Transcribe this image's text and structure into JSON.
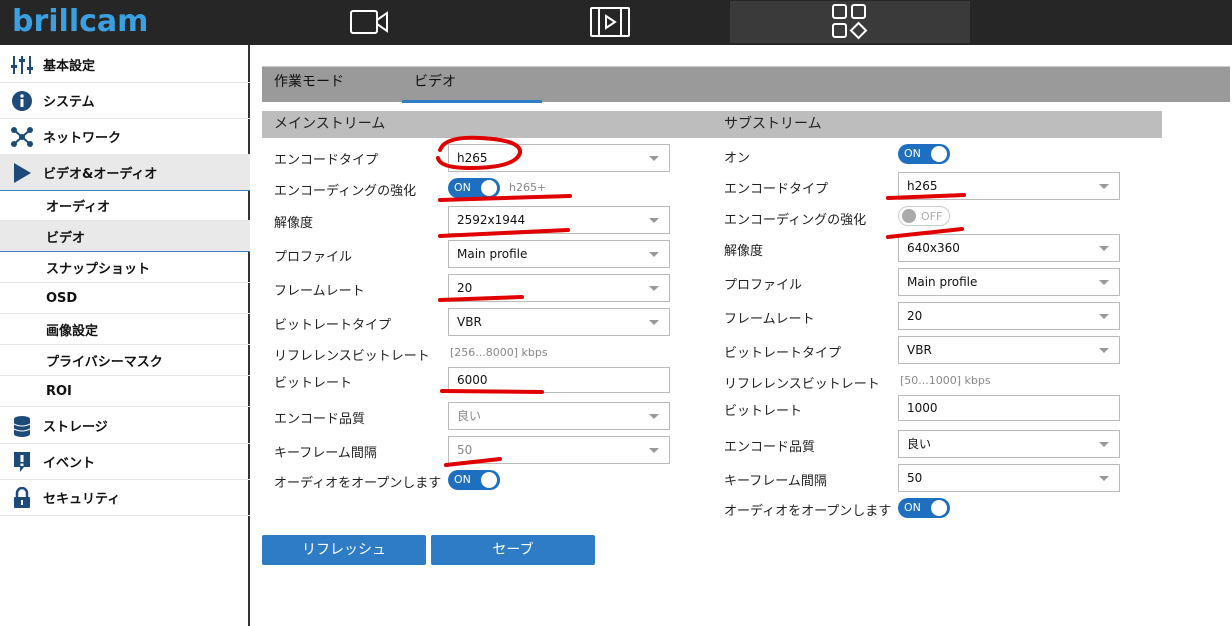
{
  "app": {
    "logo": "brillcam"
  },
  "topnav": {
    "items": [
      "live-camera",
      "playback",
      "settings"
    ]
  },
  "sidebar": {
    "items": [
      {
        "label": "基本設定",
        "icon": "sliders-icon"
      },
      {
        "label": "システム",
        "icon": "info-icon"
      },
      {
        "label": "ネットワーク",
        "icon": "network-icon"
      },
      {
        "label": "ビデオ&オーディオ",
        "icon": "play-icon"
      },
      {
        "label": "ストレージ",
        "icon": "database-icon"
      },
      {
        "label": "イベント",
        "icon": "alert-icon"
      },
      {
        "label": "セキュリティ",
        "icon": "lock-icon"
      }
    ],
    "subitems": [
      "オーディオ",
      "ビデオ",
      "スナップショット",
      "OSD",
      "画像設定",
      "プライバシーマスク",
      "ROI"
    ]
  },
  "tabs": [
    "作業モード",
    "ビデオ"
  ],
  "main_stream": {
    "title": "メインストリーム",
    "labels": {
      "encode_type": "エンコードタイプ",
      "enhance": "エンコーディングの強化",
      "resolution": "解像度",
      "profile": "プロファイル",
      "framerate": "フレームレート",
      "bitrate_type": "ビットレートタイプ",
      "ref_bitrate": "リフレレンスビットレート",
      "bitrate": "ビットレート",
      "quality": "エンコード品質",
      "keyframe": "キーフレーム間隔",
      "audio": "オーディオをオープンします"
    },
    "values": {
      "encode_type": "h265",
      "enhance_toggle": "ON",
      "enhance_hint": "h265+",
      "resolution": "2592x1944",
      "profile": "Main profile",
      "framerate": "20",
      "bitrate_type": "VBR",
      "ref_bitrate": "[256...8000] kbps",
      "bitrate": "6000",
      "quality": "良い",
      "keyframe": "50",
      "audio_toggle": "ON"
    }
  },
  "sub_stream": {
    "title": "サブストリーム",
    "labels": {
      "on": "オン",
      "encode_type": "エンコードタイプ",
      "enhance": "エンコーディングの強化",
      "resolution": "解像度",
      "profile": "プロファイル",
      "framerate": "フレームレート",
      "bitrate_type": "ビットレートタイプ",
      "ref_bitrate": "リフレレンスビットレート",
      "bitrate": "ビットレート",
      "quality": "エンコード品質",
      "keyframe": "キーフレーム間隔",
      "audio": "オーディオをオープンします"
    },
    "values": {
      "on_toggle": "ON",
      "encode_type": "h265",
      "enhance_toggle": "OFF",
      "resolution": "640x360",
      "profile": "Main profile",
      "framerate": "20",
      "bitrate_type": "VBR",
      "ref_bitrate": "[50...1000] kbps",
      "bitrate": "1000",
      "quality": "良い",
      "keyframe": "50",
      "audio_toggle": "ON"
    }
  },
  "buttons": {
    "refresh": "リフレッシュ",
    "save": "セーブ"
  },
  "colors": {
    "accent": "#2e7cc6",
    "annotation": "#e00000"
  }
}
